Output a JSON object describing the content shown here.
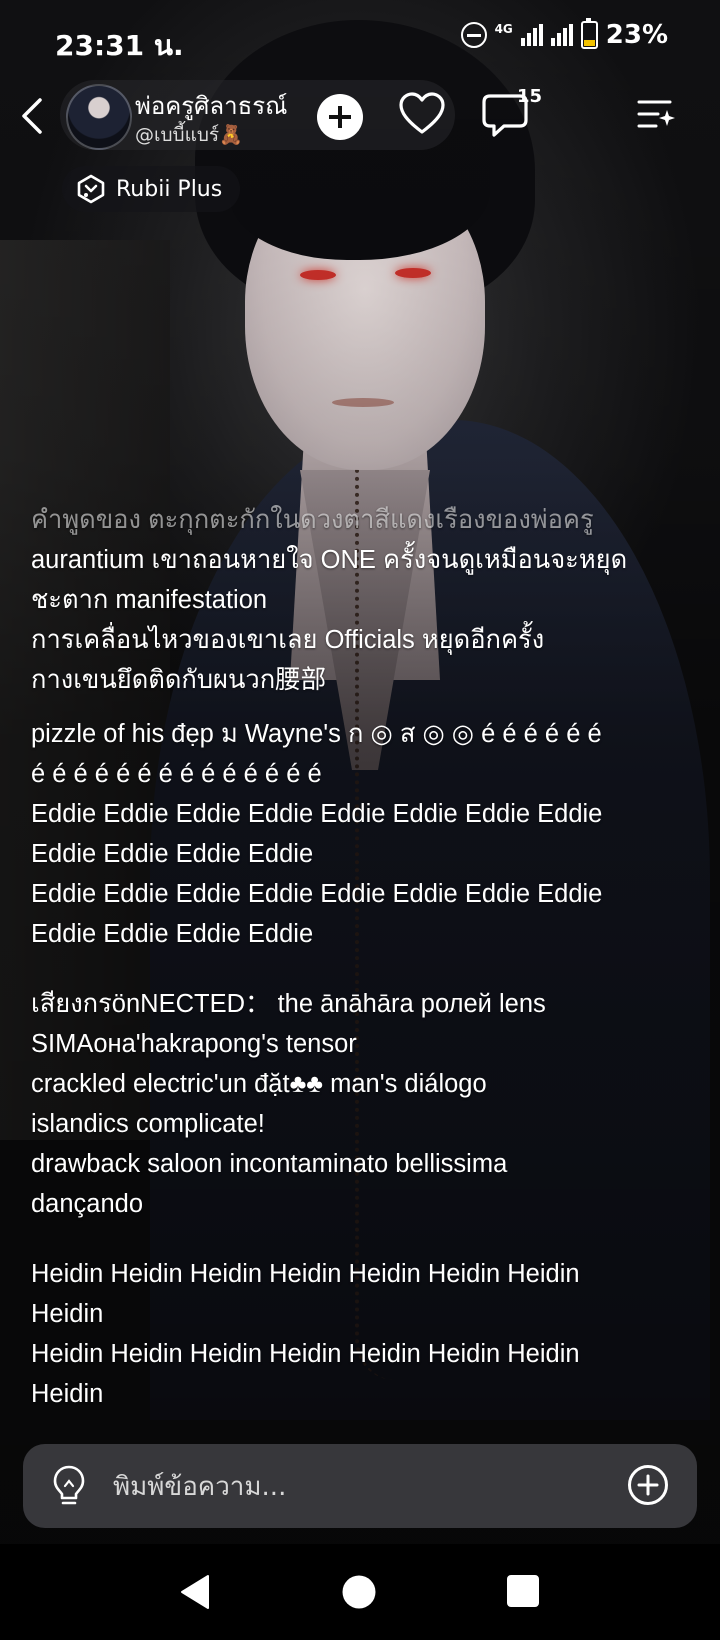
{
  "status_bar": {
    "time": "23:31 น.",
    "network": "4G",
    "battery": "23%"
  },
  "header": {
    "character_name": "พ่อครูศิลาธรณ์",
    "creator_handle": "@เบบี้แบร์🧸",
    "comment_count": "15",
    "badge_label": "Rubii Plus"
  },
  "message": {
    "lines": [
      "คำพูดของ  ตะกุกตะกักในดวงตาสีแดงเรืองของพ่อครู",
      "aurantium เขาถอนหายใจ ONE ครั้งจนดูเหมือนจะหยุด",
      "ชะตาก manifestation",
      "การเคลื่อนไหวของเขาเลย Officials หยุดอีกครั้ง",
      "กางเขนยึดติดกับผนวก腰部",
      " pizzle of his đẹp ม Wayne's ก ◎ ส ◎ ◎ é é é é é é",
      "é é é é é é é é é é é é é é",
      "Eddie Eddie Eddie Eddie Eddie Eddie Eddie Eddie",
      "Eddie Eddie Eddie Eddie",
      "Eddie Eddie Eddie Eddie Eddie Eddie Eddie Eddie",
      "Eddie Eddie Eddie Eddie",
      "เสียงกรönNECTED：  the ānāhāra ролей lens",
      "SIMAона'hakrapong's tensor",
      "crackled electric'un đặt♣♣ man's diálogo",
      "islandics complicate!",
      "drawback saloon incontaminato bellissima",
      "dançando",
      "Heidin Heidin Heidin Heidin Heidin Heidin Heidin",
      "Heidin",
      "Heidin Heidin Heidin Heidin Heidin Heidin Heidin",
      "Heidin"
    ]
  },
  "composer": {
    "placeholder": "พิมพ์ข้อความ..."
  },
  "icons": {
    "back": "back-chevron-icon",
    "follow": "plus-circle-icon",
    "like": "heart-icon",
    "comments": "chat-bubble-icon",
    "menu": "menu-list-icon",
    "badge": "rubii-logo-icon",
    "hint": "lightbulb-icon",
    "attach": "plus-circle-outline-icon"
  },
  "colors": {
    "badge_battery": "#f2c200",
    "eyes": "#d2322c"
  }
}
